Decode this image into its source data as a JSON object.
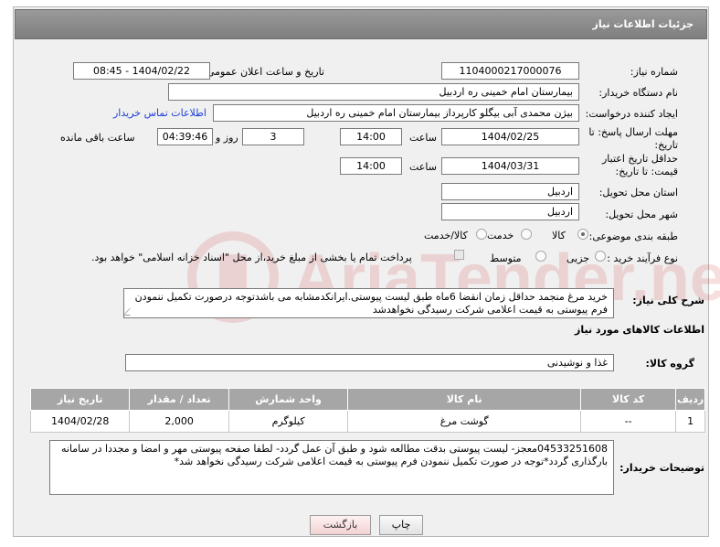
{
  "header": {
    "title": "جزئیات اطلاعات نیاز"
  },
  "labels": {
    "need_number": "شماره نیاز:",
    "announce_datetime": "تاریخ و ساعت اعلان عمومی:",
    "buyer_org": "نام دستگاه خریدار:",
    "requester": "ایجاد کننده درخواست:",
    "contact_link": "اطلاعات تماس خریدار",
    "reply_deadline": "مهلت ارسال پاسخ: تا تاریخ:",
    "time": "ساعت",
    "day_and": "روز و",
    "remaining": "ساعت باقی مانده",
    "price_validity": "حداقل تاریخ اعتبار قیمت: تا تاریخ:",
    "time2": "ساعت",
    "delivery_province": "استان محل تحویل:",
    "delivery_city": "شهر محل تحویل:",
    "category": "طبقه بندی موضوعی:",
    "category_goods": "کالا",
    "category_service": "خدمت",
    "category_goods_service": "کالا/خدمت",
    "process_type": "نوع فرآیند خرید :",
    "process_partial": "جزیی",
    "process_medium": "متوسط",
    "payment_note": "پرداخت تمام یا بخشی از مبلغ خرید،از محل \"اسناد خزانه اسلامی\" خواهد بود.",
    "description": "شرح کلی نیاز:",
    "goods_info": "اطلاعات کالاهای مورد نیاز",
    "goods_group": "گروه کالا:",
    "buyer_notes": "توضیحات خریدار:"
  },
  "values": {
    "need_number": "1104000217000076",
    "announce_datetime": "1404/02/22 - 08:45",
    "buyer_org": "بیمارستان امام خمینی  ره  اردبیل",
    "requester": "بیژن محمدی آبی بیگلو کارپرداز بیمارستان امام خمینی  ره  اردبیل",
    "reply_date": "1404/02/25",
    "reply_time": "14:00",
    "reply_days": "3",
    "reply_remaining": "04:39:46",
    "validity_date": "1404/03/31",
    "validity_time": "14:00",
    "delivery_province": "اردبیل",
    "delivery_city": "اردبیل",
    "description": "خرید مرغ منجمد حداقل زمان انقضا 6ماه طبق لیست پیوستی.ایرانکدمشابه می باشدتوجه درصورت تکمیل ننمودن فرم پیوستی به قیمت اعلامی شرکت رسیدگی نخواهدشد",
    "goods_group": "غذا و نوشیدنی",
    "buyer_notes": "04533251608معجز- لیست پیوستی بدقت مطالعه شود و طبق آن عمل گردد- لطفا صفحه پیوستی مهر و امضا و مجددا در سامانه بارگذاری گردد*توجه در صورت تکمیل ننمودن فرم پیوستی به قیمت اعلامی شرکت رسیدگی نخواهد شد*"
  },
  "table": {
    "headers": [
      "ردیف",
      "کد کالا",
      "نام کالا",
      "واحد شمارش",
      "تعداد / مقدار",
      "تاریخ نیاز"
    ],
    "rows": [
      [
        "1",
        "--",
        "گوشت مرغ",
        "کیلوگرم",
        "2,000",
        "1404/02/28"
      ]
    ]
  },
  "buttons": {
    "print": "چاپ",
    "back": "بازگشت"
  },
  "colors": {
    "header_bg": "#8c8c8c",
    "table_header_bg": "#a6a6a6",
    "link": "#1e3fd6"
  }
}
